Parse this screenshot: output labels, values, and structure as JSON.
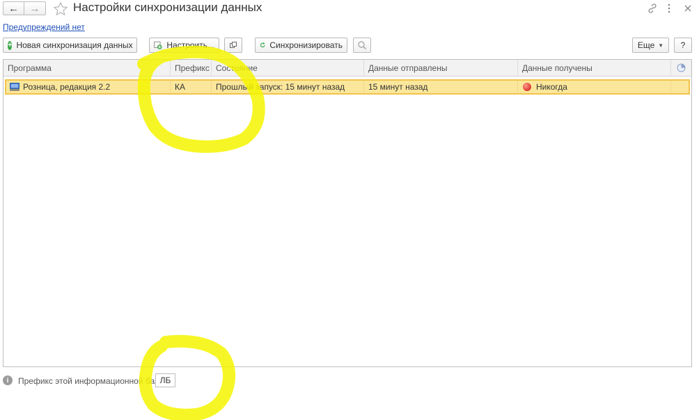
{
  "header": {
    "title": "Настройки синхронизации данных",
    "back_icon": "←",
    "forward_icon": "→"
  },
  "warnings_link": "Предупреждений нет",
  "toolbar": {
    "new_sync_label": "Новая синхронизация данных",
    "configure_label": "Настроить...",
    "sync_label": "Синхронизировать",
    "more_label": "Еще",
    "help_label": "?"
  },
  "table": {
    "columns": [
      "Программа",
      "Префикс",
      "Состояние",
      "Данные отправлены",
      "Данные получены"
    ],
    "rows": [
      {
        "program": "Розница, редакция 2.2",
        "prefix": "КА",
        "state": "Прошлый запуск: 15 минут назад",
        "sent": "15 минут назад",
        "received": "Никогда"
      }
    ]
  },
  "footer": {
    "prefix_label": "Префикс этой информационной базы:",
    "prefix_value": "ЛБ"
  },
  "colors": {
    "link": "#1f4fb8",
    "selected_row": "#fbe79c",
    "selected_row_border": "#f1c34b",
    "highlight_marker": "#f5f500",
    "status_red": "#e0443a",
    "add_green": "#3ca84a"
  }
}
